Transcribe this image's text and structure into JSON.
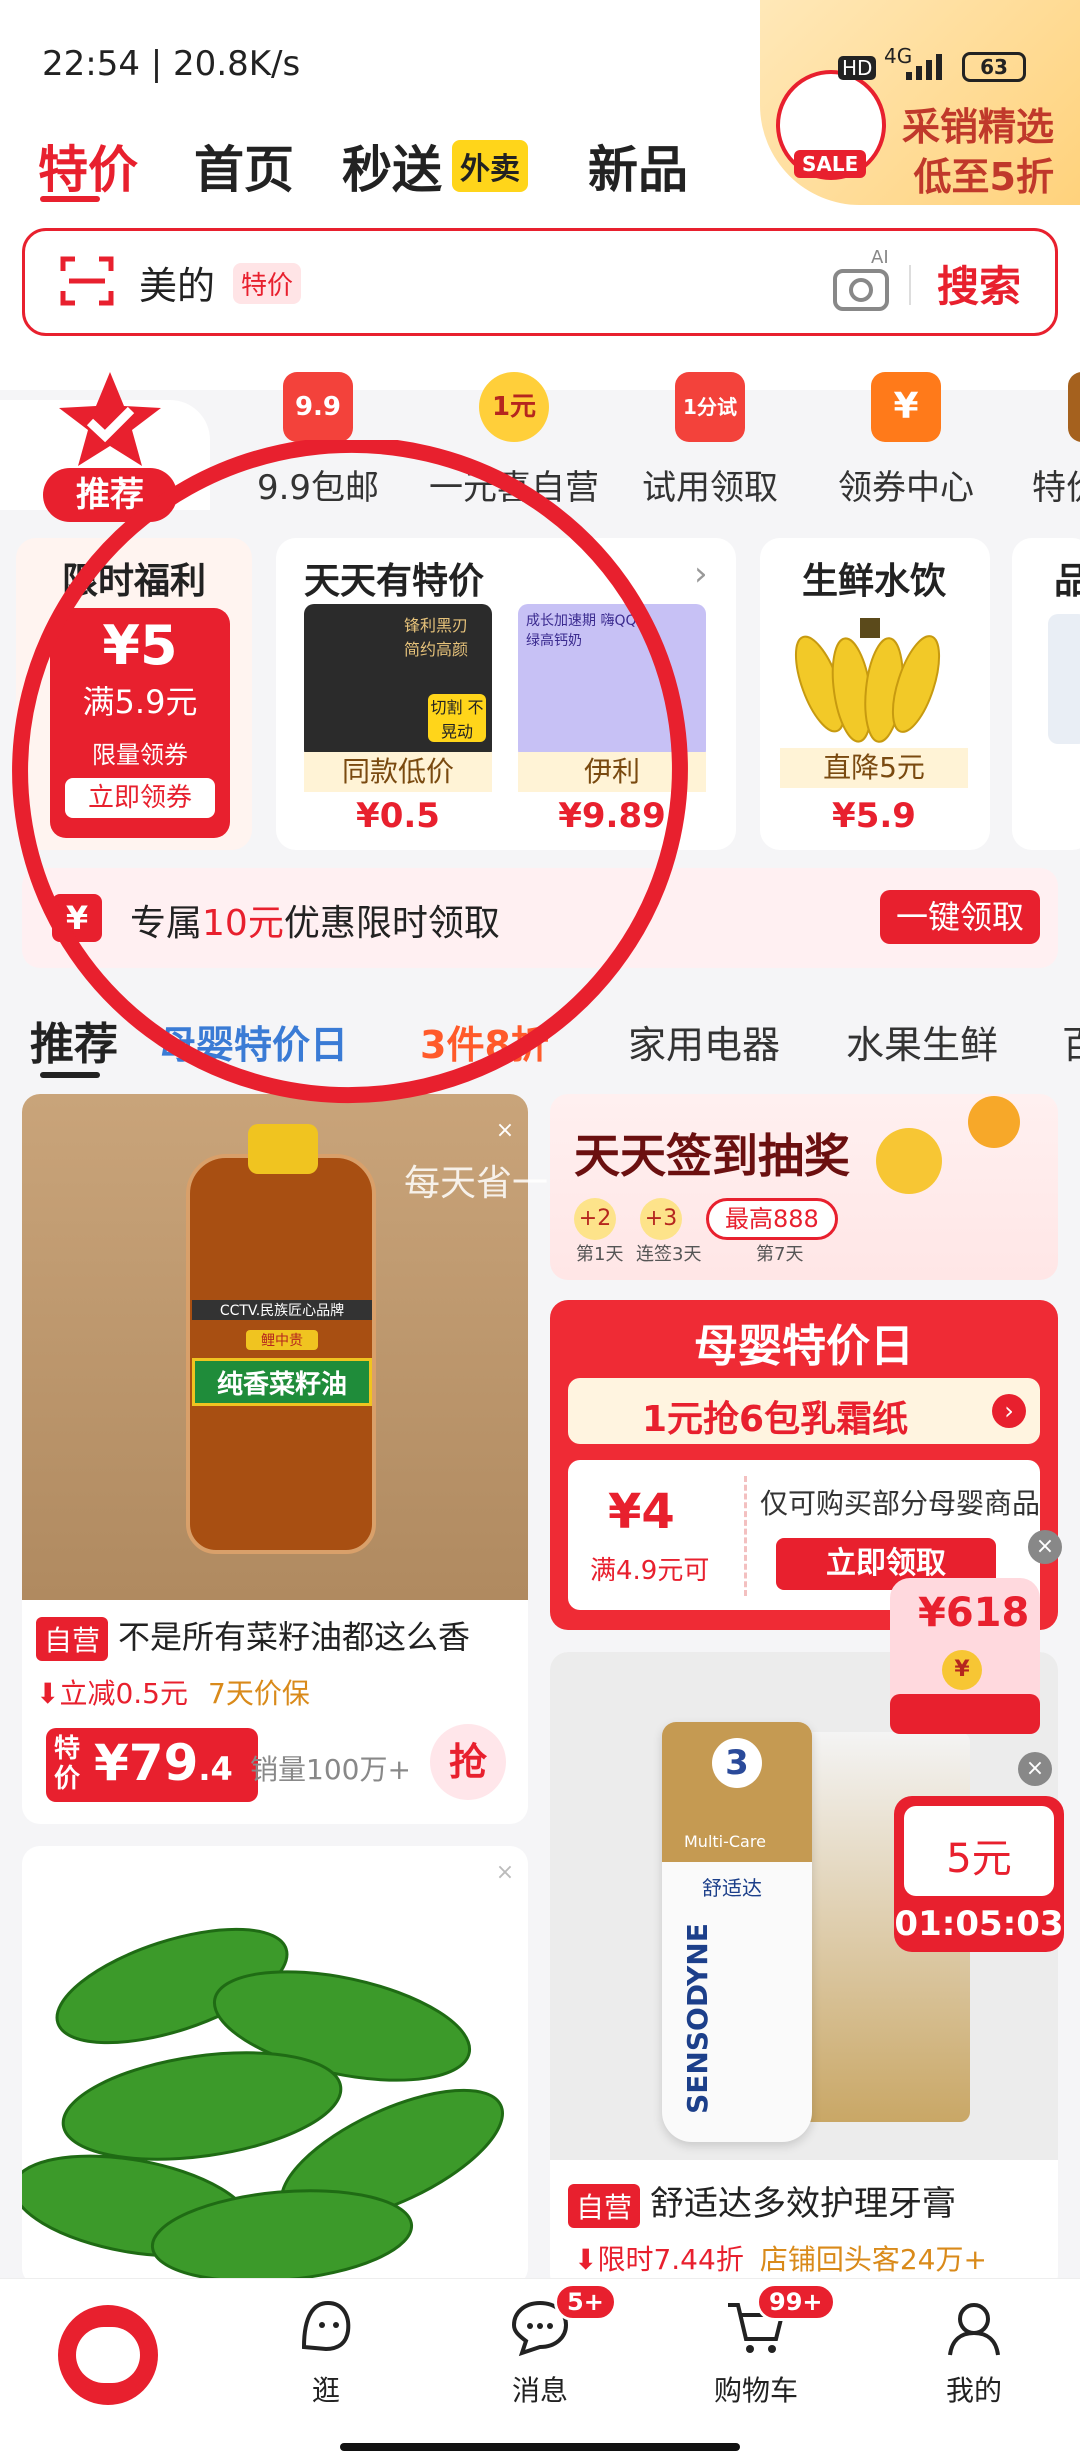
{
  "status": {
    "time": "22:54 | 20.8K/s",
    "hd": "HD",
    "net": "4G",
    "battery": "63"
  },
  "tabs": [
    {
      "label": "特价"
    },
    {
      "label": "首页"
    },
    {
      "label": "秒送"
    },
    {
      "label": "新品"
    }
  ],
  "tab_badge": "外卖",
  "promo": {
    "line1": "采销精选",
    "line2": "低至5折",
    "mascot_tag": "SALE"
  },
  "search": {
    "text": "美的",
    "tag": "特价",
    "button": "搜索",
    "ai": "AI"
  },
  "categories": [
    {
      "label": "推荐",
      "icon": "star-check"
    },
    {
      "label": "9.9包邮",
      "icon": "9.9"
    },
    {
      "label": "一元喜自营",
      "icon": "1元"
    },
    {
      "label": "试用领取",
      "icon": "1分试"
    },
    {
      "label": "领券中心",
      "icon": "¥"
    },
    {
      "label": "特价"
    }
  ],
  "welfare": {
    "title": "限时福利",
    "amount": "¥5",
    "condition": "满5.9元",
    "limit": "限量领券",
    "button": "立即领券"
  },
  "daily": {
    "title": "天天有特价",
    "items": [
      {
        "img_text": "锋利黑刃 简约高颜",
        "img_badge": "切割 不晃动",
        "tag": "同款低价",
        "price": "¥0.5"
      },
      {
        "img_text": "成长加速期 嗨QQ星绿高钙奶",
        "tag": "伊利",
        "price": "¥9.89"
      }
    ]
  },
  "fresh": {
    "title": "生鲜水饮",
    "tag": "直降5元",
    "price": "¥5.9"
  },
  "partial_card": {
    "title": "品"
  },
  "strip": {
    "prefix": "专属",
    "amount": "10元",
    "suffix": "优惠限时领取",
    "button": "一键领取"
  },
  "feed_tabs": [
    "推荐",
    "母婴特价日",
    "3件8折",
    "家用电器",
    "水果生鲜",
    "百"
  ],
  "watermark": "每天省一点",
  "oil": {
    "self": "自营",
    "title": "不是所有菜籽油都这么香",
    "discount": "立减0.5元",
    "guarantee": "7天价保",
    "special": "特价",
    "price_int": "¥79",
    "price_dec": ".4",
    "sales": "销量100万+",
    "grab": "抢",
    "bottle_label": "纯香菜籽油",
    "brand": "CCTV.民族匠心品牌",
    "brand2": "鲤中贵"
  },
  "signin": {
    "title": "天天签到抽奖",
    "b1": "+2",
    "b2": "+3",
    "max": "最高888",
    "d1": "第1天",
    "d2": "连签3天",
    "d3": "第7天"
  },
  "baby": {
    "title": "母婴特价日",
    "sub": "1元抢6包乳霜纸",
    "amount": "¥4",
    "cond": "满4.9元可",
    "desc": "仅可购买部分母婴商品",
    "button": "立即领取"
  },
  "float618": {
    "tag": "¥618",
    "amount": "5元",
    "timer": "01:05:03"
  },
  "toothpaste": {
    "self": "自营",
    "title": "舒适达多效护理牙膏",
    "discount": "限时7.44折",
    "note": "店铺回头客24万+",
    "brand": "SENSODYNE",
    "sub": "舒适达",
    "n": "3",
    "mc": "Multi-Care"
  },
  "nav": [
    {
      "label": ""
    },
    {
      "label": "逛"
    },
    {
      "label": "消息",
      "badge": "5+"
    },
    {
      "label": "购物车",
      "badge": "99+"
    },
    {
      "label": "我的"
    }
  ]
}
